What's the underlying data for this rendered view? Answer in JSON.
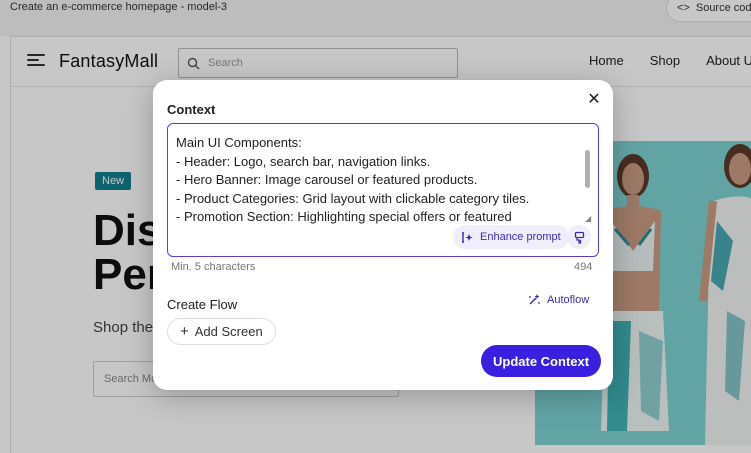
{
  "app": {
    "title": "Create an e-commerce homepage - model-3",
    "source_code_label": "Source code",
    "source_code_glyph": "<>"
  },
  "site": {
    "brand": "FantasyMall",
    "search_placeholder": "Search",
    "nav": [
      "Home",
      "Shop",
      "About Us"
    ],
    "badge": "New",
    "hero_title_line1": "Dis",
    "hero_title_line2": "Per",
    "hero_sub": "Shop the",
    "hero_search_placeholder": "Search Mo"
  },
  "modal": {
    "context_label": "Context",
    "close_glyph": "✕",
    "context_text": "Main UI Components:\n- Header: Logo, search bar, navigation links.\n- Hero Banner: Image carousel or featured products.\n- Product Categories: Grid layout with clickable category tiles.\n- Promotion Section: Highlighting special offers or featured",
    "enhance_label": "Enhance prompt",
    "min_chars": "Min. 5 characters",
    "char_count": "494",
    "flow_label": "Create Flow",
    "autoflow_label": "Autoflow",
    "add_screen_label": "Add Screen",
    "add_glyph": "+",
    "update_label": "Update Context"
  },
  "colors": {
    "accent": "#3b1fe0",
    "accent_text": "#3a2db0",
    "badge": "#12818e",
    "hero_bg": "#7ed3d3"
  }
}
